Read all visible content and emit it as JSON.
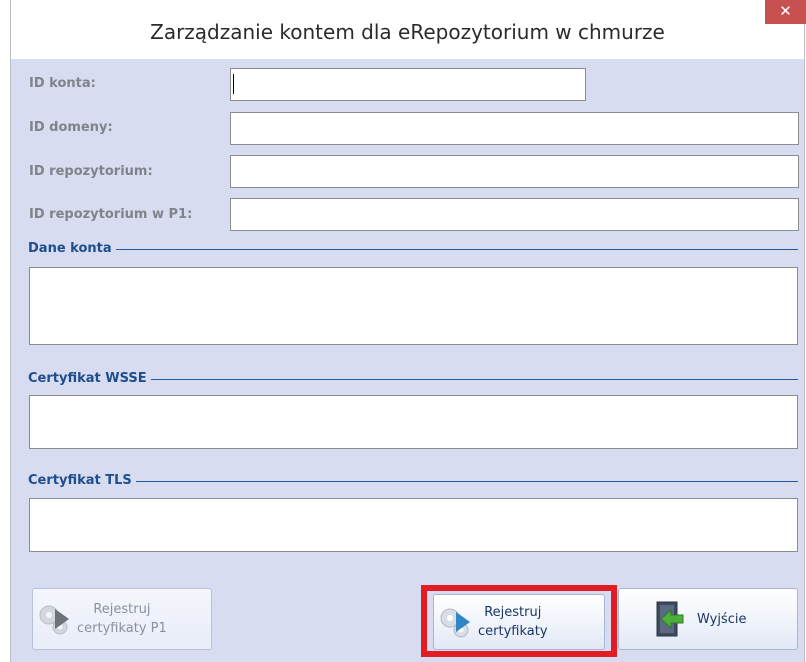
{
  "window": {
    "title": "Zarządzanie kontem dla eRepozytorium w chmurze",
    "close_glyph": "✕"
  },
  "fields": {
    "account_id": {
      "label": "ID konta:",
      "value": ""
    },
    "domain_id": {
      "label": "ID domeny:",
      "value": ""
    },
    "repository_id": {
      "label": "ID repozytorium:",
      "value": ""
    },
    "repository_p1_id": {
      "label": "ID repozytorium w P1:",
      "value": ""
    }
  },
  "sections": {
    "account_data": {
      "label": "Dane konta",
      "value": ""
    },
    "wsse_certificate": {
      "label": "Certyfikat WSSE",
      "value": ""
    },
    "tls_certificate": {
      "label": "Certyfikat TLS",
      "value": ""
    }
  },
  "buttons": {
    "register_p1": {
      "label_line1": "Rejestruj",
      "label_line2": "certyfikaty P1",
      "enabled": false,
      "icon": "gear-play-icon"
    },
    "register": {
      "label_line1": "Rejestruj",
      "label_line2": "certyfikaty",
      "enabled": true,
      "icon": "gear-play-icon"
    },
    "exit": {
      "label": "Wyjście",
      "enabled": true,
      "icon": "exit-door-icon"
    }
  },
  "colors": {
    "background": "#d7dcf1",
    "section_label": "#1f4e8c",
    "field_label": "#808389",
    "close_button": "#c75050",
    "highlight": "#e21c22"
  }
}
